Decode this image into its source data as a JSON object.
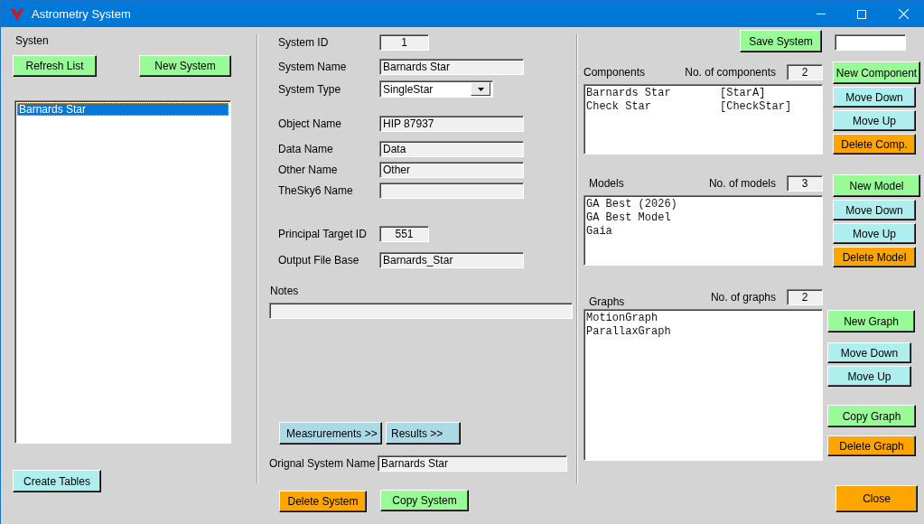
{
  "window": {
    "title": "Astrometry System"
  },
  "system_panel": {
    "label": "Systen",
    "buttons": [
      {
        "label": "Refresh List",
        "color": "#98fb98"
      },
      {
        "label": "New System",
        "color": "#98fb98"
      }
    ],
    "systems": [
      {
        "name": "Barnards Star",
        "selected": true
      }
    ],
    "footer_button": {
      "label": "Create Tables",
      "color": "#afeeee"
    }
  },
  "details": {
    "fields": [
      {
        "label": "System ID",
        "value": "1",
        "kind": "number"
      },
      {
        "label": "System Name",
        "value": "Barnards Star",
        "kind": "text"
      },
      {
        "label": "System Type",
        "value": "SingleStar",
        "kind": "dropdown"
      },
      {
        "label": "Object Name",
        "value": "HIP 87937",
        "kind": "text"
      },
      {
        "label": "Data Name",
        "value": "Data",
        "kind": "text"
      },
      {
        "label": "Other Name",
        "value": "Other",
        "kind": "text"
      },
      {
        "label": "TheSky6 Name",
        "kind": "text"
      },
      {
        "label": "Principal Target ID",
        "value": "551",
        "kind": "number"
      },
      {
        "label": "Output File Base",
        "value": "Barnards_Star",
        "kind": "text"
      }
    ],
    "notes": {
      "label": "Notes"
    },
    "nav_buttons": [
      {
        "label": "Measrurements >>",
        "color": "#add8e6"
      },
      {
        "label": "Results >>",
        "color": "#add8e6"
      }
    ],
    "original_name": {
      "label": "Orignal System Name",
      "value": "Barnards Star"
    },
    "buttons": [
      {
        "label": "Delete System",
        "color": "#ffa500"
      },
      {
        "label": "Copy System",
        "color": "#98fb98"
      }
    ]
  },
  "right_panel": {
    "save_button": {
      "label": "Save System",
      "color": "#98fb98"
    },
    "sections": [
      {
        "title": "Components",
        "count_label": "No. of components",
        "count": "2",
        "items": [
          {
            "text": "Barnards Star",
            "tag": "[StarA]"
          },
          {
            "text": "Check Star",
            "tag": "[CheckStar]"
          }
        ],
        "buttons": [
          {
            "label": "New Component",
            "color": "#98fb98"
          },
          {
            "label": "Move Down",
            "color": "#afeeee"
          },
          {
            "label": "Move Up",
            "color": "#afeeee"
          },
          {
            "label": "Delete Comp.",
            "color": "#ffa500"
          }
        ]
      },
      {
        "title": "Models",
        "count_label": "No. of models",
        "count": "3",
        "items": [
          {
            "text": "GA Best (2026)"
          },
          {
            "text": "GA Best Model"
          },
          {
            "text": "Gaia"
          }
        ],
        "buttons": [
          {
            "label": "New Model",
            "color": "#98fb98"
          },
          {
            "label": "Move Down",
            "color": "#afeeee"
          },
          {
            "label": "Move Up",
            "color": "#afeeee"
          },
          {
            "label": "Delete Model",
            "color": "#ffa500"
          }
        ]
      },
      {
        "title": "Graphs",
        "count_label": "No. of graphs",
        "count": "2",
        "items": [
          {
            "text": "MotionGraph"
          },
          {
            "text": "ParallaxGraph"
          }
        ],
        "buttons": [
          {
            "label": "New Graph",
            "color": "#98fb98"
          },
          {
            "label": "Move Down",
            "color": "#afeeee"
          },
          {
            "label": "Move Up",
            "color": "#afeeee"
          },
          {
            "label": "Copy Graph",
            "color": "#98fb98"
          },
          {
            "label": "Delete Graph",
            "color": "#ffa500"
          }
        ]
      }
    ],
    "close_button": {
      "label": "Close",
      "color": "#ffa500"
    }
  }
}
